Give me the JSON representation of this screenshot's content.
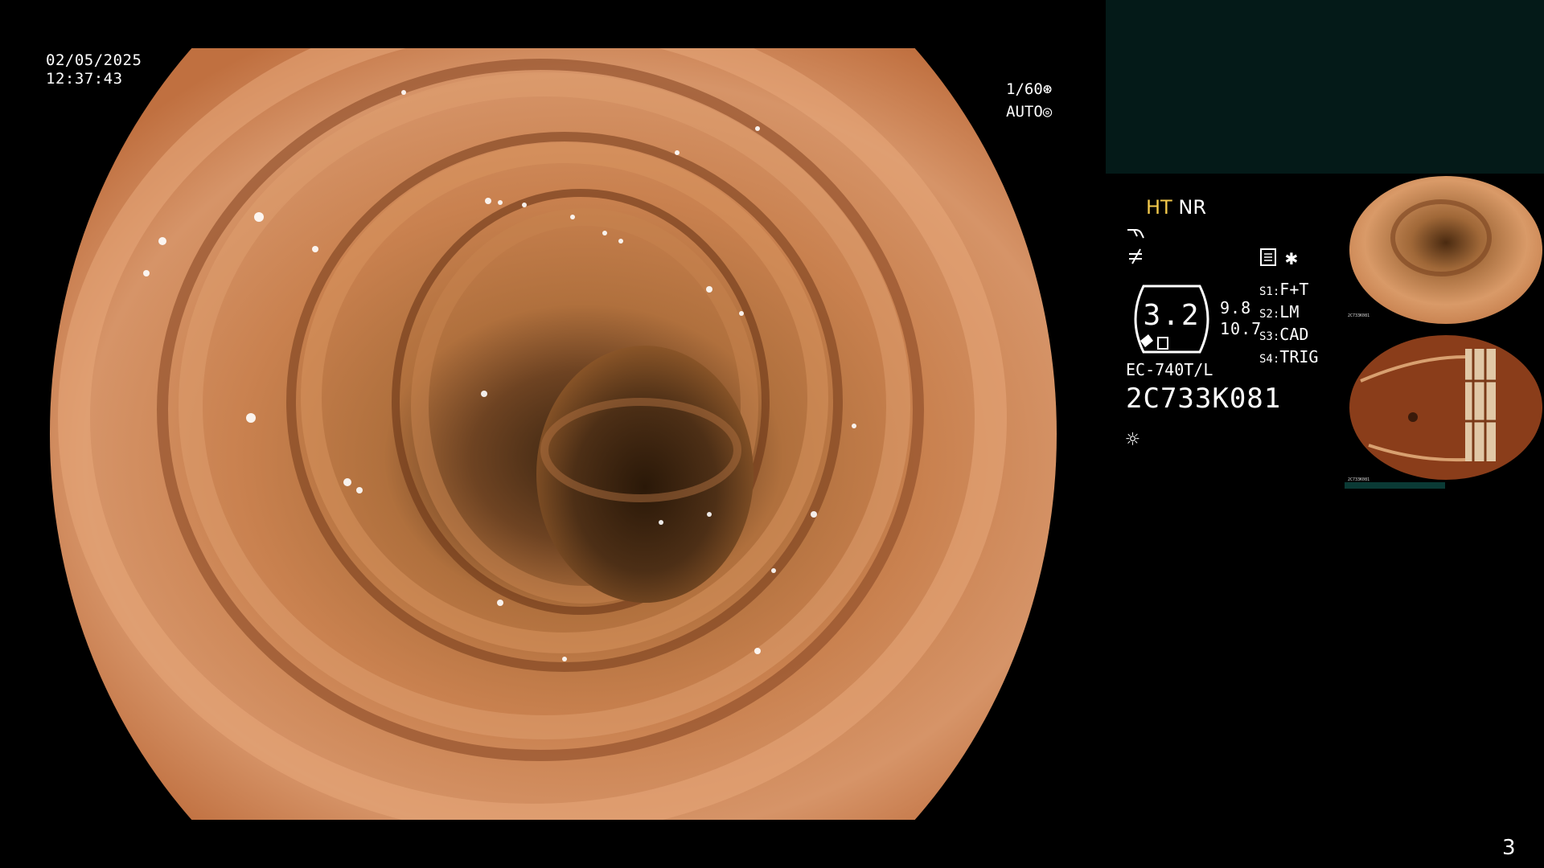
{
  "header": {
    "date": "02/05/2025",
    "time": "12:37:43"
  },
  "shutter": {
    "speed": "1/60",
    "mode": "AUTO",
    "speed_icon": "aperture-icon",
    "mode_icon": "iris-icon"
  },
  "enhancement": {
    "ht": "HT",
    "nr": "NR",
    "ht_color": "#f2c84b"
  },
  "icons": {
    "icon1": "curve-wave-icon",
    "icon2": "signal-slash-icon",
    "icon3": "document-list-icon",
    "icon4": "asterisk-icon",
    "icon5": "brightness-sun-icon"
  },
  "zoom": {
    "value": "3.2",
    "left_value": "9.8",
    "right_value": "10.7"
  },
  "switches": [
    {
      "key": "S1:",
      "value": "F+T"
    },
    {
      "key": "S2:",
      "value": "LM"
    },
    {
      "key": "S3:",
      "value": "CAD"
    },
    {
      "key": "S4:",
      "value": "TRIG"
    }
  ],
  "scope": {
    "model": "EC-740T/L",
    "serial": "2C733K081"
  },
  "thumbnails": {
    "t1_label": "2C733K081",
    "t2_label": "2C733K081"
  },
  "footer": {
    "page": "3"
  },
  "colors": {
    "background": "#000000",
    "teal_panel": "#041a18",
    "mucosa": "#c8784a"
  }
}
